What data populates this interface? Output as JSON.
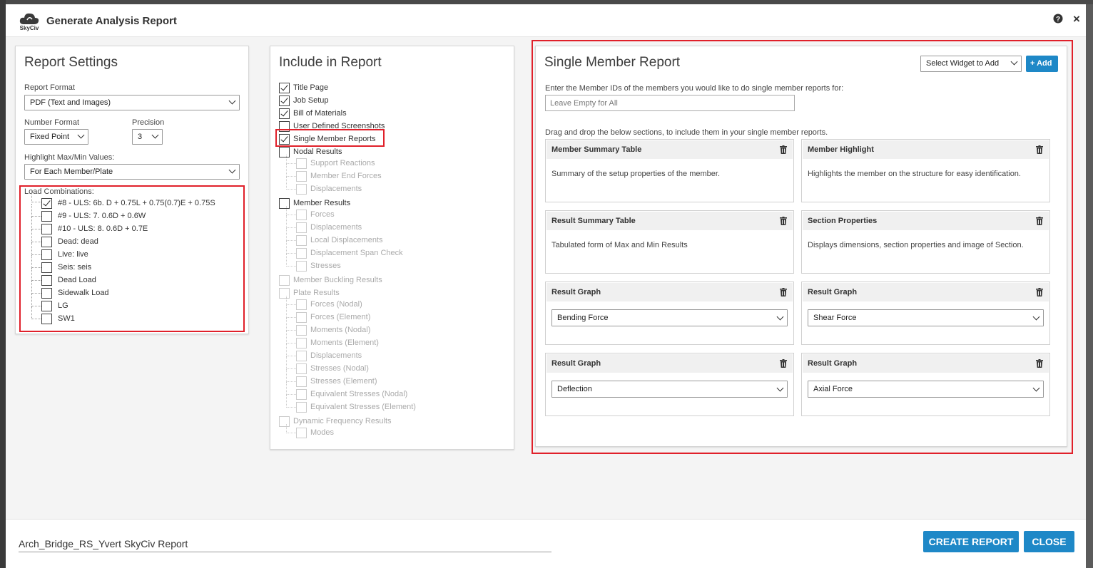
{
  "header": {
    "logo_text": "SkyCiv",
    "title": "Generate Analysis Report",
    "help_icon": "?",
    "close_icon": "×"
  },
  "report_settings": {
    "title": "Report Settings",
    "report_format_label": "Report Format",
    "report_format_value": "PDF (Text and Images)",
    "number_format_label": "Number Format",
    "number_format_value": "Fixed Point",
    "precision_label": "Precision",
    "precision_value": "3",
    "highlight_label": "Highlight Max/Min Values:",
    "highlight_value": "For Each Member/Plate",
    "load_combinations_label": "Load Combinations:",
    "load_combinations": [
      {
        "label": "#8 - ULS: 6b. D + 0.75L + 0.75(0.7)E + 0.75S",
        "checked": true
      },
      {
        "label": "#9 - ULS: 7. 0.6D + 0.6W",
        "checked": false
      },
      {
        "label": "#10 - ULS: 8. 0.6D + 0.7E",
        "checked": false
      },
      {
        "label": "Dead: dead",
        "checked": false
      },
      {
        "label": "Live: live",
        "checked": false
      },
      {
        "label": "Seis: seis",
        "checked": false
      },
      {
        "label": "Dead Load",
        "checked": false
      },
      {
        "label": "Sidewalk Load",
        "checked": false
      },
      {
        "label": "LG",
        "checked": false
      },
      {
        "label": "SW1",
        "checked": false
      }
    ]
  },
  "include": {
    "title": "Include in Report",
    "items": [
      {
        "label": "Title Page",
        "checked": true
      },
      {
        "label": "Job Setup",
        "checked": true
      },
      {
        "label": "Bill of Materials",
        "checked": true
      },
      {
        "label": "User Defined Screenshots",
        "checked": false
      },
      {
        "label": "Single Member Reports",
        "checked": true
      },
      {
        "label": "Nodal Results",
        "checked": false
      },
      {
        "label": "Support Reactions",
        "checked": false
      },
      {
        "label": "Member End Forces",
        "checked": false
      },
      {
        "label": "Displacements",
        "checked": false
      },
      {
        "label": "Member Results",
        "checked": false
      },
      {
        "label": "Forces",
        "checked": false
      },
      {
        "label": "Displacements",
        "checked": false
      },
      {
        "label": "Local Displacements",
        "checked": false
      },
      {
        "label": "Displacement Span Check",
        "checked": false
      },
      {
        "label": "Stresses",
        "checked": false
      },
      {
        "label": "Member Buckling Results",
        "checked": false
      },
      {
        "label": "Plate Results",
        "checked": false
      },
      {
        "label": "Forces (Nodal)",
        "checked": false
      },
      {
        "label": "Forces (Element)",
        "checked": false
      },
      {
        "label": "Moments (Nodal)",
        "checked": false
      },
      {
        "label": "Moments (Element)",
        "checked": false
      },
      {
        "label": "Displacements",
        "checked": false
      },
      {
        "label": "Stresses (Nodal)",
        "checked": false
      },
      {
        "label": "Stresses (Element)",
        "checked": false
      },
      {
        "label": "Equivalent Stresses (Nodal)",
        "checked": false
      },
      {
        "label": "Equivalent Stresses (Element)",
        "checked": false
      },
      {
        "label": "Dynamic Frequency Results",
        "checked": false
      },
      {
        "label": "Modes",
        "checked": false
      }
    ]
  },
  "single_member": {
    "title": "Single Member Report",
    "widget_select_value": "Select Widget to Add",
    "add_button": "+ Add",
    "member_ids_label": "Enter the Member IDs of the members you would like to do single member reports for:",
    "member_ids_placeholder": "Leave Empty for All",
    "drag_hint": "Drag and drop the below sections, to include them in your single member reports.",
    "widgets": [
      {
        "title": "Member Summary Table",
        "description": "Summary of the setup properties of the member."
      },
      {
        "title": "Member Highlight",
        "description": "Highlights the member on the structure for easy identification."
      },
      {
        "title": "Result Summary Table",
        "description": "Tabulated form of Max and Min Results"
      },
      {
        "title": "Section Properties",
        "description": "Displays dimensions, section properties and image of Section."
      },
      {
        "title": "Result Graph",
        "select": "Bending Force"
      },
      {
        "title": "Result Graph",
        "select": "Shear Force"
      },
      {
        "title": "Result Graph",
        "select": "Deflection"
      },
      {
        "title": "Result Graph",
        "select": "Axial Force"
      }
    ]
  },
  "footer": {
    "report_name": "Arch_Bridge_RS_Yvert SkyCiv Report",
    "create_button": "CREATE REPORT",
    "close_button": "CLOSE"
  },
  "colors": {
    "accent": "#1e88c7",
    "highlight_box": "#e0202a"
  }
}
